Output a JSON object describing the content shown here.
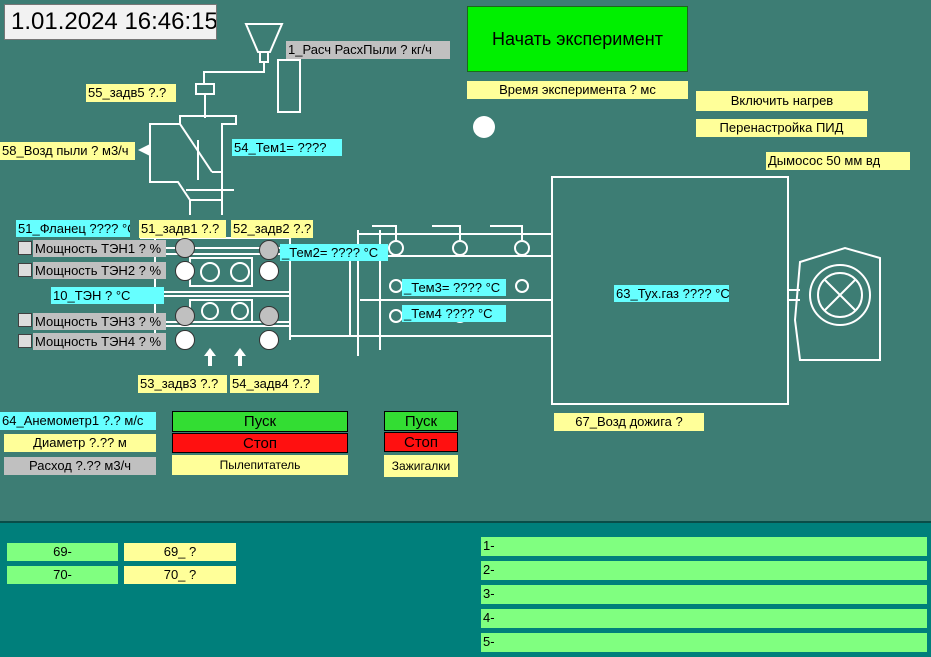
{
  "clock": "1.01.2024 16:46:15",
  "start_button": "Начать эксперимент",
  "exp_time": "Время эксперимента  ? мс",
  "heat_on": "Включить нагрев",
  "pid_retune": "Перенастройка ПИД",
  "smoke_exhauster": "Дымосос    50 мм вд",
  "dust_calc": "1_Расч РасхПыли  ? кг/ч",
  "valve5": "55_задв5   ?.?",
  "air_dust": "58_Возд пыли  ? м3/ч",
  "temp1": "54_Тем1=  ????",
  "flange": "51_Фланец  ???? °С",
  "valve1": "51_задв1   ?.?",
  "valve2": "52_задв2   ?.?",
  "temp2": "_Тем2=  ???? °С",
  "heaters": [
    "Мощность ТЭН1  ? %",
    "Мощность ТЭН2  ? %",
    "Мощность ТЭН3  ? %",
    "Мощность ТЭН4  ? %"
  ],
  "ten10": "10_ТЭН  ? °С",
  "temp3": "_Тем3=  ???? °С",
  "temp4": "_Тем4  ???? °С",
  "flue_gas": "63_Тух.газ  ???? °С",
  "valve3": "53_задв3   ?.?",
  "valve4": "54_задв4   ?.?",
  "afterburn_air": "67_Возд дожига  ?",
  "anemometer": "64_Анемометр1   ?.? м/с",
  "diameter": "Диаметр    ?.?? м",
  "flow": "Расход   ?.?? м3/ч",
  "feeder": {
    "start": "Пуск",
    "stop": "Стоп",
    "label": "Пылепитатель"
  },
  "igniters": {
    "start": "Пуск",
    "stop": "Стоп",
    "label": "Зажигалки"
  },
  "bottom_left": {
    "a69": "69-",
    "b69": "69_  ?",
    "a70": "70-",
    "b70": "70_  ?"
  },
  "messages": [
    "1-",
    "2-",
    "3-",
    "4-",
    "5-"
  ]
}
